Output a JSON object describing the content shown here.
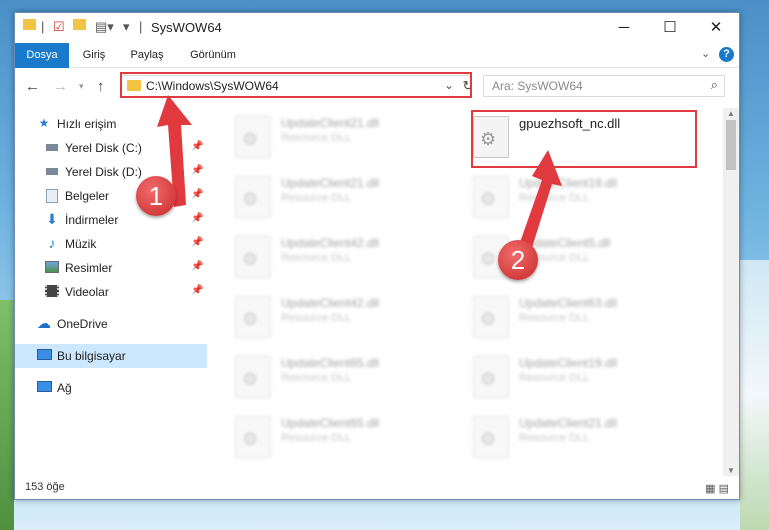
{
  "window": {
    "title": "SysWOW64",
    "controls": {
      "minimize": "─",
      "maximize": "☐",
      "close": "✕"
    }
  },
  "ribbon": {
    "tabs": [
      "Dosya",
      "Giriş",
      "Paylaş",
      "Görünüm"
    ]
  },
  "nav": {
    "address": "C:\\Windows\\SysWOW64",
    "search_placeholder": "Ara: SysWOW64"
  },
  "sidebar": {
    "items": [
      {
        "label": "Hızlı erişim",
        "icon": "star-icon",
        "pinned": false
      },
      {
        "label": "Yerel Disk (C:)",
        "icon": "drive-icon",
        "pinned": true
      },
      {
        "label": "Yerel Disk (D:)",
        "icon": "drive-icon",
        "pinned": true
      },
      {
        "label": "Belgeler",
        "icon": "documents-icon",
        "pinned": true
      },
      {
        "label": "İndirmeler",
        "icon": "download-icon",
        "pinned": true
      },
      {
        "label": "Müzik",
        "icon": "music-icon",
        "pinned": true
      },
      {
        "label": "Resimler",
        "icon": "pictures-icon",
        "pinned": true
      },
      {
        "label": "Videolar",
        "icon": "videos-icon",
        "pinned": true
      },
      {
        "label": "OneDrive",
        "icon": "cloud-icon",
        "pinned": false
      },
      {
        "label": "Bu bilgisayar",
        "icon": "computer-icon",
        "pinned": false,
        "selected": true
      },
      {
        "label": "Ağ",
        "icon": "network-icon",
        "pinned": false
      }
    ]
  },
  "files": [
    {
      "name": "UpdateClient21.dll",
      "type": "Resource DLL"
    },
    {
      "name": "gpuezhsoft_nc.dll",
      "type": "",
      "highlighted": true
    },
    {
      "name": "UpdateClient21.dll",
      "type": "Resource DLL"
    },
    {
      "name": "UpdateClient19.dll",
      "type": "Resource DLL"
    },
    {
      "name": "UpdateClient42.dll",
      "type": "Resource DLL"
    },
    {
      "name": "UpdateClient5.dll",
      "type": "Resource DLL"
    },
    {
      "name": "UpdateClient42.dll",
      "type": "Resource DLL"
    },
    {
      "name": "UpdateClient63.dll",
      "type": "Resource DLL"
    },
    {
      "name": "UpdateClient65.dll",
      "type": "Resource DLL"
    },
    {
      "name": "UpdateClient19.dll",
      "type": "Resource DLL"
    },
    {
      "name": "UpdateClient65.dll",
      "type": "Resource DLL"
    },
    {
      "name": "UpdateClient21.dll",
      "type": "Resource DLL"
    }
  ],
  "status": {
    "item_count": "153 öğe"
  },
  "annotations": {
    "step1": "1",
    "step2": "2",
    "color": "#e0393e"
  }
}
